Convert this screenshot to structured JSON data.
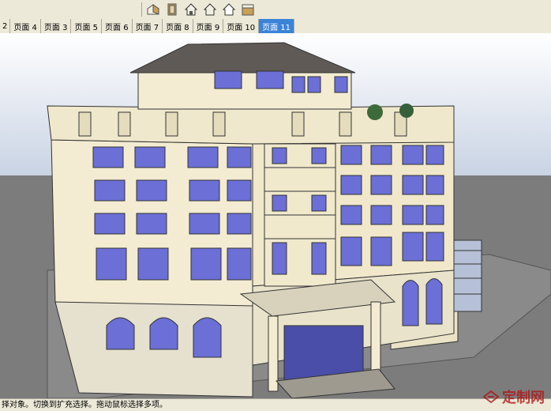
{
  "toolbar": {
    "buttons": [
      {
        "name": "iso-view",
        "icon": "house-iso-icon"
      },
      {
        "name": "top-view",
        "icon": "house-top-icon"
      },
      {
        "name": "front-view",
        "icon": "house-front-icon"
      },
      {
        "name": "right-view",
        "icon": "house-right-icon"
      },
      {
        "name": "back-view",
        "icon": "house-back-icon"
      },
      {
        "name": "left-view",
        "icon": "house-left-icon"
      }
    ]
  },
  "scene_tabs": {
    "items": [
      "2",
      "页面 4",
      "页面 3",
      "页面 5",
      "页面 6",
      "页面 7",
      "页面 8",
      "页面 9",
      "页面 10",
      "页面 11"
    ],
    "active": "页面 11"
  },
  "status_bar": {
    "text": "择对象。切换到扩充选择。拖动鼠标选择多项。"
  },
  "watermark": {
    "text": "定制网"
  },
  "colors": {
    "sky_top": "#ffffff",
    "sky_bottom": "#c9d3e4",
    "ground": "#7c7c7c",
    "wall": "#f3ecd2",
    "window": "#6b6fd6",
    "roof": "#5f5a56",
    "accent_tab": "#3b83d8"
  }
}
